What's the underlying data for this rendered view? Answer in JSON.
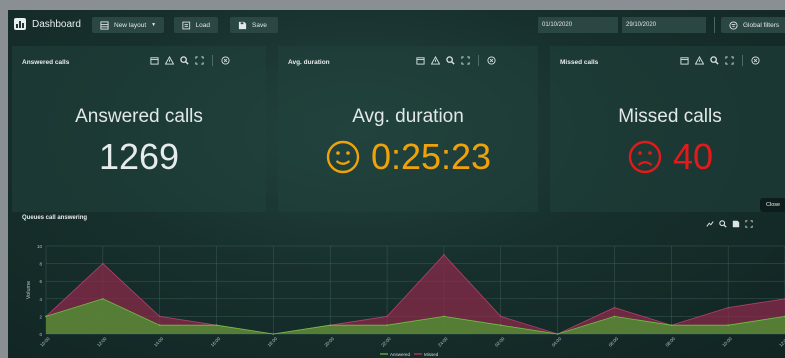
{
  "app": {
    "title": "Dashboard"
  },
  "toolbar": {
    "layout_label": "New layout",
    "load_label": "Load",
    "save_label": "Save",
    "date_from": "01/10/2020",
    "date_to": "29/10/2020",
    "global_filters_label": "Global filters"
  },
  "panels": [
    {
      "header": "Answered calls",
      "label": "Answered calls",
      "value": "1269",
      "color": "#e6ecec",
      "icon": "none"
    },
    {
      "header": "Avg. duration",
      "label": "Avg. duration",
      "value": "0:25:23",
      "color": "#f0a20a",
      "icon": "smile-icon"
    },
    {
      "header": "Missed calls",
      "label": "Missed calls",
      "value": "40",
      "color": "#e41a1a",
      "icon": "frown-icon"
    }
  ],
  "chart": {
    "title": "Queues call answering",
    "tooltip": "Close"
  },
  "chart_data": {
    "type": "area",
    "ylabel": "Volume",
    "ylim": [
      0,
      10
    ],
    "yticks": [
      0,
      2,
      4,
      6,
      8,
      10
    ],
    "x": [
      "10:00",
      "12:00",
      "14:00",
      "16:00",
      "18:00",
      "20:00",
      "22:00",
      "24:00",
      "02:00",
      "04:00",
      "06:00",
      "08:00",
      "10:00",
      "12:00"
    ],
    "series": [
      {
        "name": "Answered",
        "color": "#4f9a33",
        "values": [
          2,
          4,
          1,
          1,
          0,
          1,
          1,
          2,
          1,
          0,
          2,
          1,
          1,
          2
        ]
      },
      {
        "name": "Missed",
        "color": "#8a2a4a",
        "values": [
          2,
          8,
          2,
          1,
          0,
          1,
          2,
          9,
          2,
          0,
          3,
          1,
          3,
          4
        ]
      }
    ],
    "legend_position": "bottom-center",
    "grid": true
  },
  "colors": {
    "accent": "#f0a20a",
    "danger": "#e41a1a",
    "answered": "#4f9a33",
    "missed": "#8a2a4a"
  }
}
